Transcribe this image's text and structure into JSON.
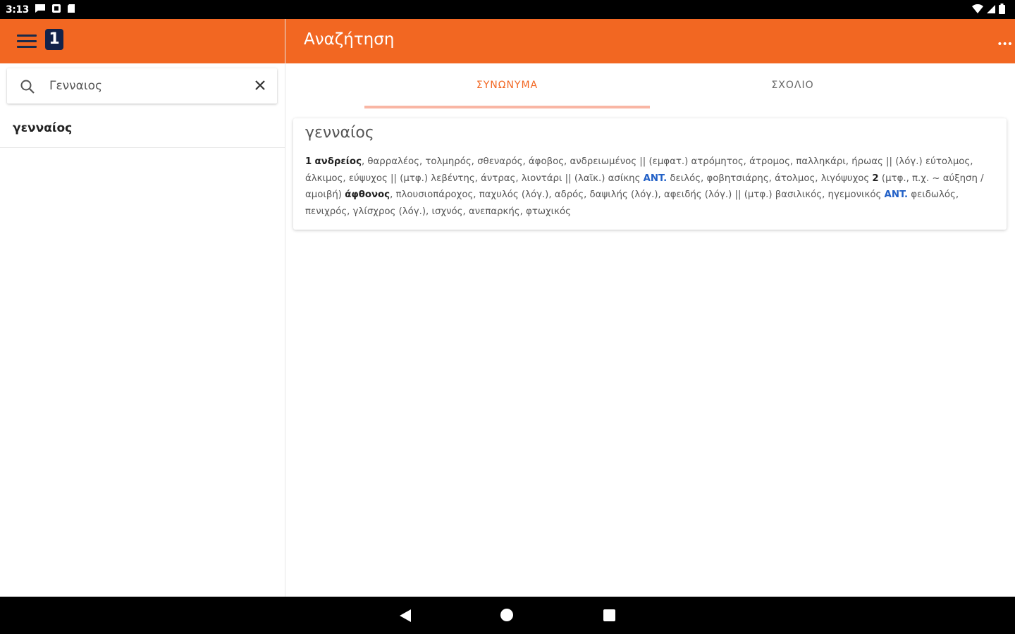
{
  "status_bar": {
    "time": "3:13"
  },
  "left_panel": {
    "search": {
      "value": "Γενναιος",
      "placeholder": ""
    },
    "results": [
      {
        "label": "γενναίος"
      }
    ]
  },
  "header": {
    "title": "Αναζήτηση"
  },
  "tabs": [
    {
      "label": "ΣΥΝΩΝΥΜΑ",
      "active": true
    },
    {
      "label": "ΣΧΟΛΙΟ",
      "active": false
    }
  ],
  "entry": {
    "title": "γενναίος",
    "line1_num": "1",
    "line1_head": "ανδρείος",
    "line1_text": ", θαρραλέος, τολμηρός, σθεναρός, άφοβος, ανδρειωμένος || (εμφατ.) ατρόμητος, άτρομος, παλληκάρι, ήρωας || (λόγ.) εύτολμος, άλκιμος, εύψυχος || (μτφ.) λεβέντης, άντρας, λιοντάρι || (λαϊκ.) ασίκης ",
    "ant1": "ANT.",
    "line1_tail": " δειλός, φοβητσιάρης, άτολμος, λιγόψυχος ",
    "sense2_num": "2",
    "sense2_text": " (μτφ., π.χ. ~ αύξηση / αμοιβή) ",
    "sense2_head": "άφθονος",
    "sense2_rest": ", πλουσιοπάροχος, παχυλός (λόγ.), αδρός, δαψιλής (λόγ.), αφειδής (λόγ.) || (μτφ.) βασιλικός, ηγεμονικός ",
    "ant2": "ANT.",
    "sense2_tail": " φειδωλός, πενιχρός, γλίσχρος (λόγ.), ισχνός, ανεπαρκής, φτωχικός"
  },
  "colors": {
    "accent": "#f26722",
    "logo": "#12234a",
    "ant": "#2361c7",
    "tab_indicator": "#f9b6a4"
  },
  "icons": {
    "menu": "hamburger-icon",
    "logo": "1",
    "search": "search-icon",
    "clear": "close-icon",
    "overflow": "more-icon",
    "nav_back": "back-triangle-icon",
    "nav_home": "home-circle-icon",
    "nav_recents": "recents-square-icon"
  }
}
